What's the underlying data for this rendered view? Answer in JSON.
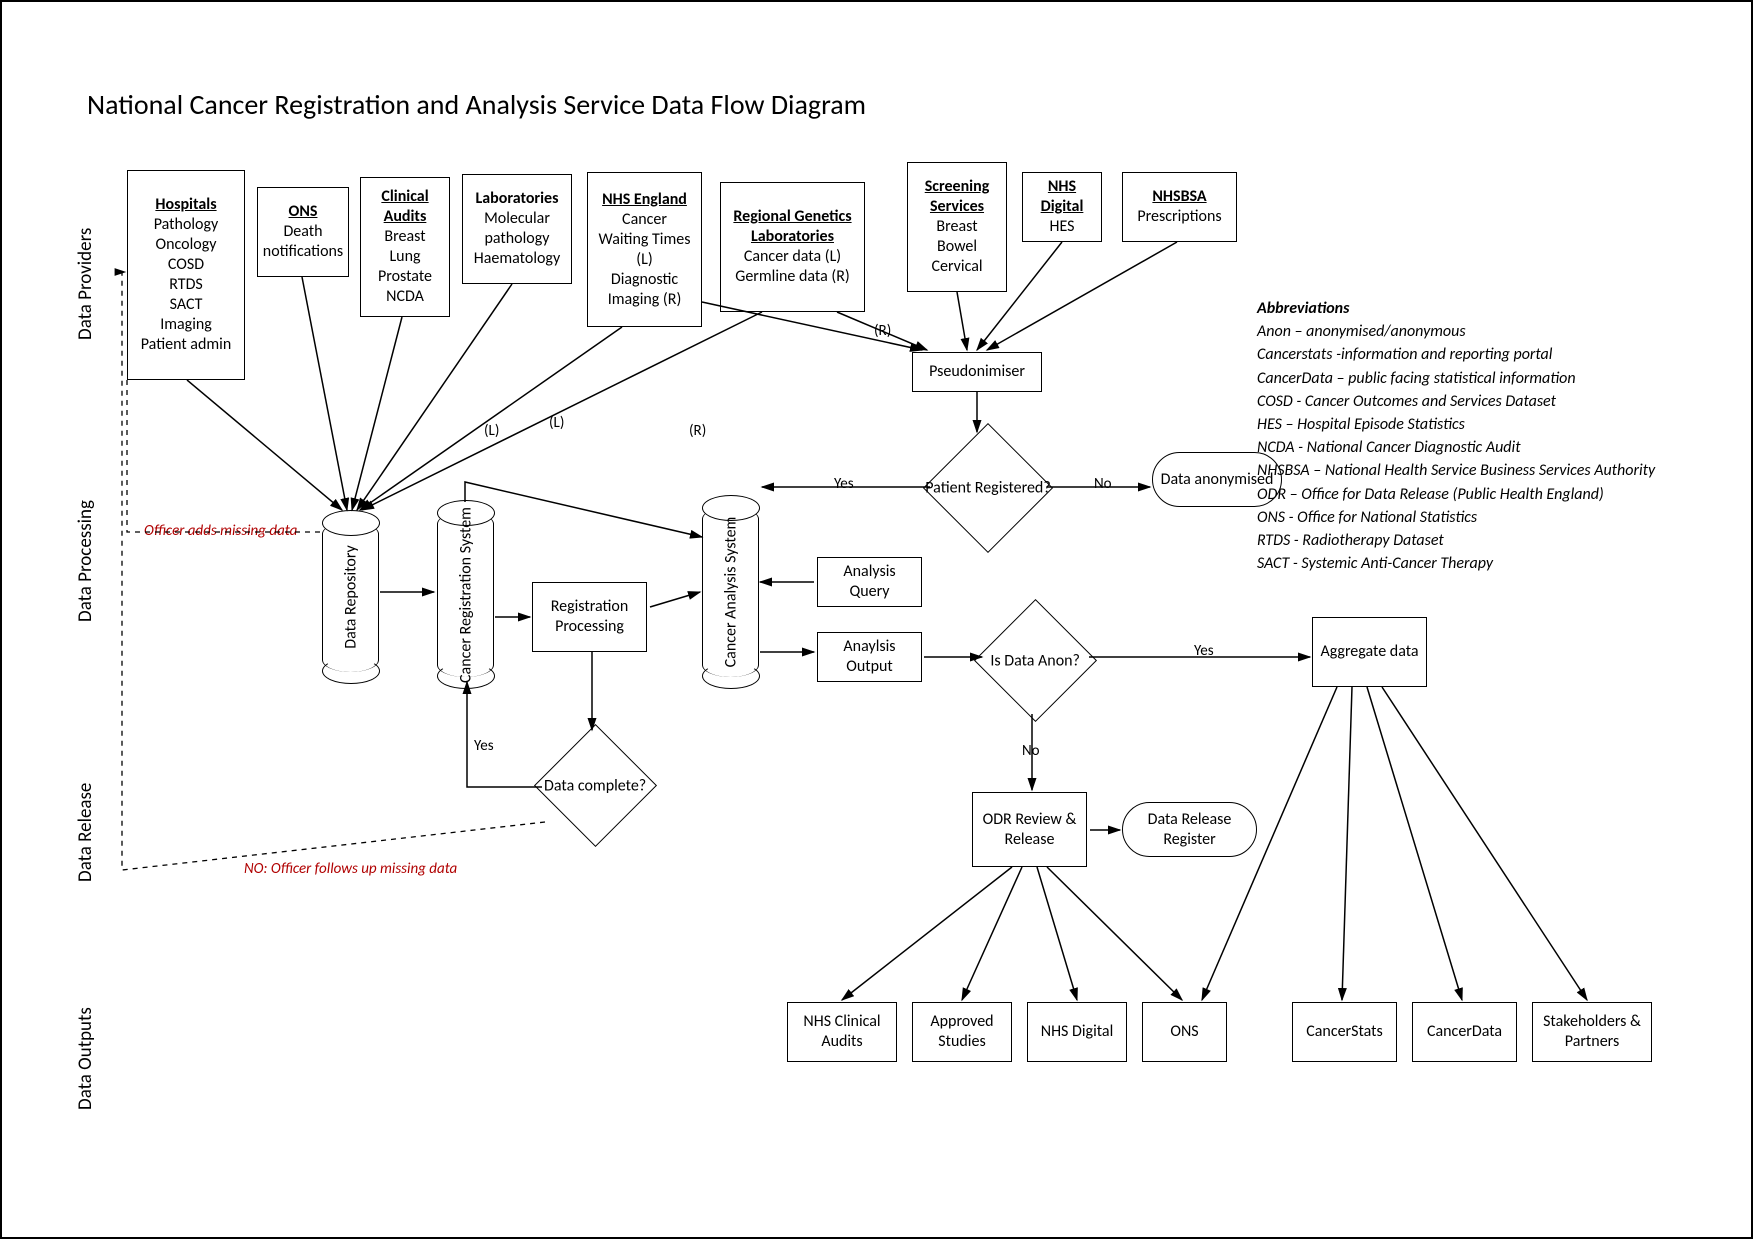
{
  "title": "National Cancer Registration and Analysis Service Data Flow Diagram",
  "lanes": {
    "providers": "Data Providers",
    "processing": "Data Processing",
    "release": "Data Release",
    "outputs": "Data Outputs"
  },
  "providers": {
    "hospitals": {
      "hd": "Hospitals",
      "lines": [
        "Pathology",
        "Oncology",
        "COSD",
        "RTDS",
        "SACT",
        "Imaging",
        "Patient admin"
      ]
    },
    "ons": {
      "hd": "ONS",
      "lines": [
        "Death",
        "notifications"
      ]
    },
    "audits": {
      "hd": "Clinical Audits",
      "lines": [
        "Breast",
        "Lung",
        "Prostate",
        "NCDA"
      ]
    },
    "labs": {
      "hd": "Laboratories",
      "lines": [
        "Molecular",
        "pathology",
        "Haematology"
      ]
    },
    "nhs_england": {
      "hd": "NHS England",
      "lines": [
        "Cancer",
        "Waiting Times",
        "(L)",
        "Diagnostic",
        "Imaging (R)"
      ]
    },
    "genetics": {
      "hd": "Regional Genetics Laboratories",
      "lines": [
        "Cancer data (L)",
        "Germline data (R)"
      ]
    },
    "screening": {
      "hd": "Screening Services",
      "lines": [
        "Breast",
        "Bowel",
        "Cervical"
      ]
    },
    "nhs_digital": {
      "hd": "NHS Digital",
      "lines": [
        "HES"
      ]
    },
    "nhsbsa": {
      "hd": "NHSBSA",
      "lines": [
        "Prescriptions"
      ]
    }
  },
  "processing": {
    "pseudonimiser": "Pseudonimiser",
    "patient_registered": "Patient Registered?",
    "data_anonymised": "Data anonymised",
    "data_repo": "Data Repository",
    "cancer_reg": "Cancer Registration System",
    "registration_processing": "Registration Processing",
    "cancer_analysis": "Cancer Analysis System",
    "analysis_query": "Analysis Query",
    "analysis_output": "Anaylsis Output",
    "is_anon": "Is Data Anon?",
    "aggregate": "Aggregate data",
    "data_complete": "Data complete?",
    "officer_adds": "Officer adds missing data",
    "officer_follows": "NO: Officer follows up missing data"
  },
  "release": {
    "odr": "ODR Review & Release",
    "register": "Data Release Register"
  },
  "outputs": {
    "nhs_clinical": "NHS Clinical Audits",
    "approved": "Approved Studies",
    "nhs_digital": "NHS Digital",
    "ons": "ONS",
    "cancerstats": "CancerStats",
    "cancerdata": "CancerData",
    "stakeholders": "Stakeholders & Partners"
  },
  "edge_labels": {
    "L": "(L)",
    "R": "(R)",
    "yes": "Yes",
    "no": "No"
  },
  "abbrev": {
    "hd": "Abbreviations",
    "lines": [
      "Anon – anonymised/anonymous",
      "Cancerstats -information and reporting portal",
      "CancerData – public facing statistical information",
      "COSD - Cancer Outcomes and Services Dataset",
      "HES – Hospital Episode Statistics",
      "NCDA - National Cancer Diagnostic Audit",
      "NHSBSA – National Health Service Business Services Authority",
      "ODR – Office for Data Release (Public Health England)",
      "ONS - Office for National Statistics",
      "RTDS - Radiotherapy Dataset",
      "SACT - Systemic Anti-Cancer Therapy"
    ]
  }
}
